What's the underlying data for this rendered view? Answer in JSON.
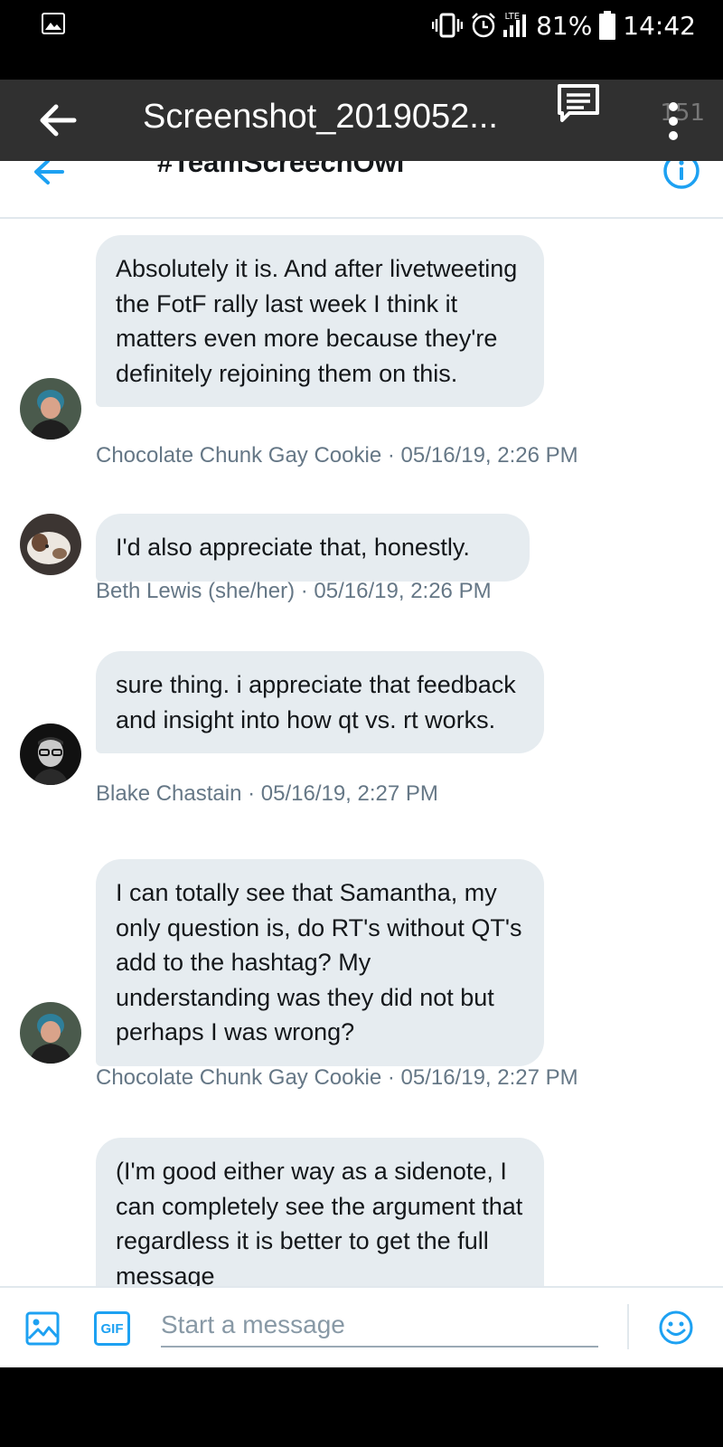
{
  "status_bar": {
    "network": "LTE",
    "battery": "81%",
    "time": "14:42"
  },
  "viewer": {
    "title": "Screenshot_2019052...",
    "ghost_time": "151",
    "icons": [
      "back-arrow-icon",
      "comment-icon",
      "more-vert-icon"
    ]
  },
  "dm_header": {
    "title": "#TeamScreechOwl",
    "icons": [
      "back-arrow-icon",
      "info-icon"
    ]
  },
  "messages": [
    {
      "text": "Absolutely it is. And after livetweeting the FotF rally last week I think it matters even more because they're definitely rejoining them on this.",
      "meta": "Chocolate Chunk Gay Cookie · 05/16/19, 2:26 PM",
      "avatar": "woman-blue-hair"
    },
    {
      "text": "I'd also appreciate that, honestly.",
      "meta": "Beth Lewis (she/her) · 05/16/19, 2:26 PM",
      "avatar": "dog"
    },
    {
      "text": "sure thing. i appreciate that feedback and insight into how qt vs. rt works.",
      "meta": "Blake Chastain · 05/16/19, 2:27 PM",
      "avatar": "man-glasses"
    },
    {
      "text": "I can totally see that Samantha, my only question is, do RT's without QT's add to the hashtag? My understanding was they did not but perhaps I was wrong?",
      "meta": "Chocolate Chunk Gay Cookie · 05/16/19, 2:27 PM",
      "avatar": "woman-blue-hair"
    },
    {
      "text": "(I'm good either way as a sidenote, I can completely see the argument that regardless it is better to get the full message",
      "meta": "",
      "avatar": ""
    }
  ],
  "composer": {
    "placeholder": "Start a message",
    "gif_label": "GIF",
    "accent": "#1da1f2"
  }
}
